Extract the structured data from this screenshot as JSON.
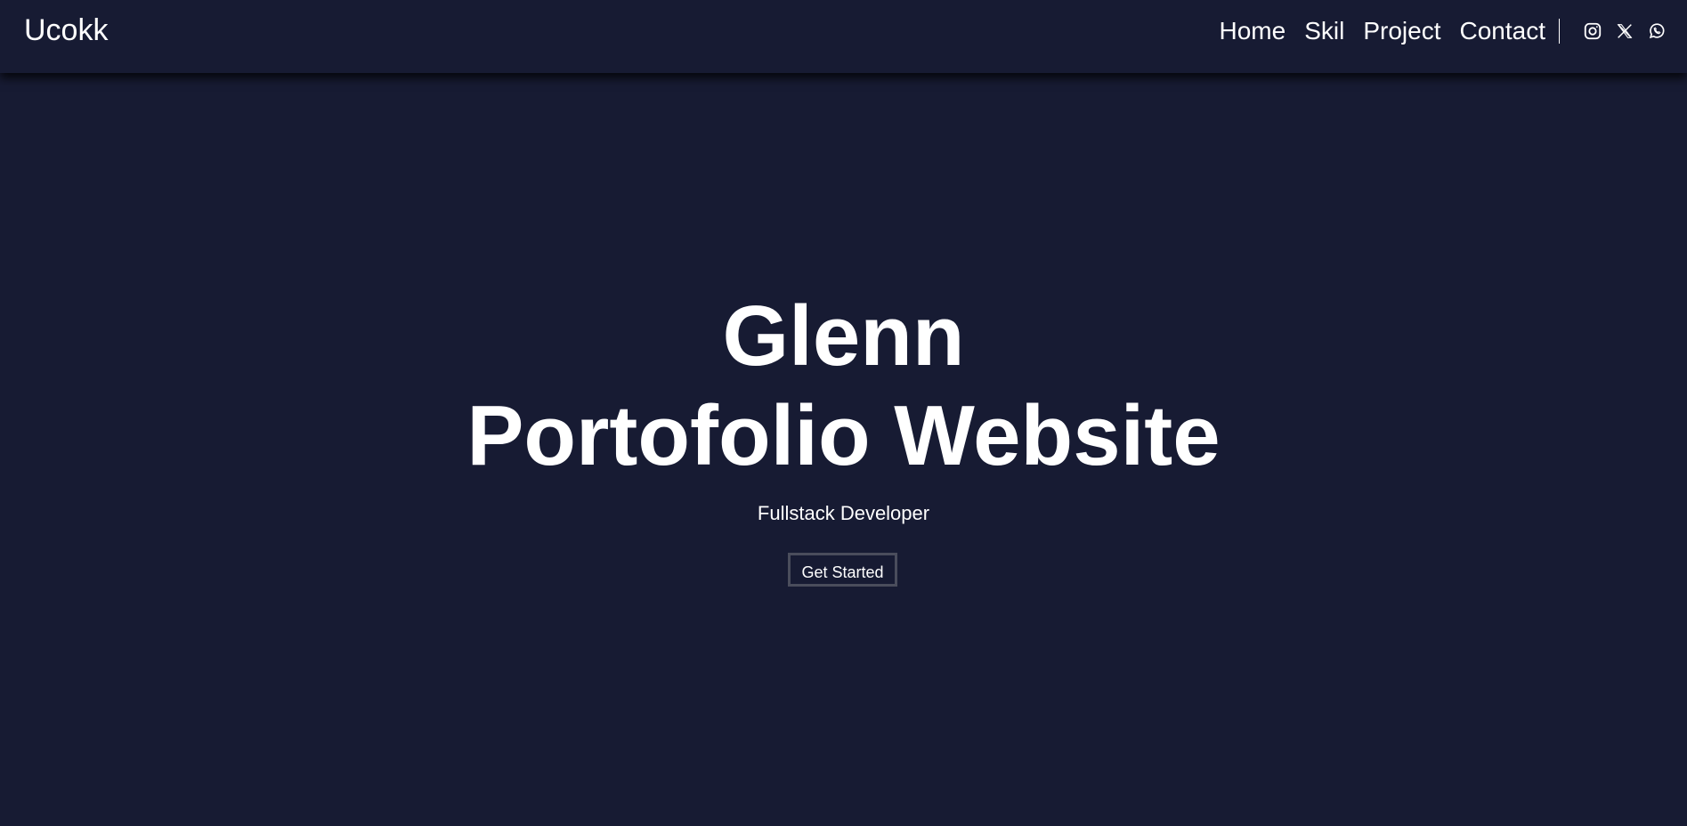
{
  "nav": {
    "brand": "Ucokk",
    "links": [
      "Home",
      "Skil",
      "Project",
      "Contact"
    ],
    "social_icons": [
      "instagram-icon",
      "x-icon",
      "whatsapp-icon"
    ]
  },
  "hero": {
    "title_line1": "Glenn",
    "title_line2": "Portofolio Website",
    "subtitle": "Fullstack Developer",
    "cta_label": "Get Started"
  },
  "colors": {
    "background": "#171b33",
    "text": "#ffffff",
    "button_border": "#4a4d5c"
  }
}
